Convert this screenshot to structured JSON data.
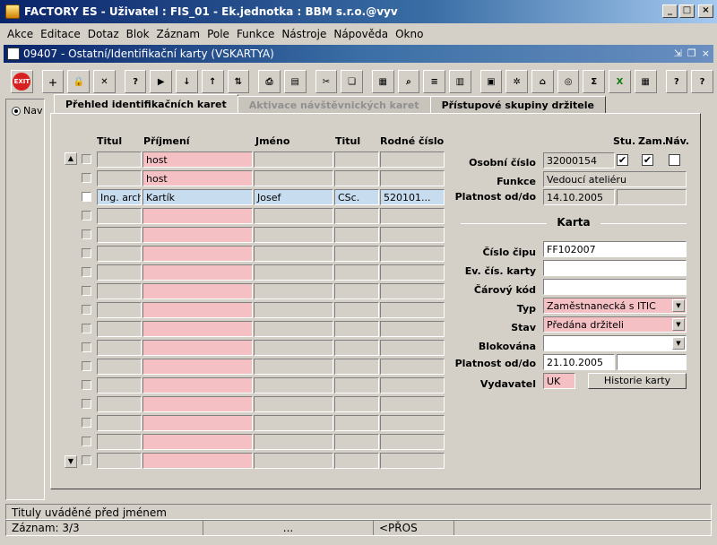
{
  "window": {
    "title": "FACTORY ES - Uživatel : FIS_01 - Ek.jednotka : BBM s.r.o.@vyv"
  },
  "menu": [
    "Akce",
    "Editace",
    "Dotaz",
    "Blok",
    "Záznam",
    "Pole",
    "Funkce",
    "Nástroje",
    "Nápověda",
    "Okno"
  ],
  "form": {
    "title": "09407 - Ostatní/Identifikační karty (VSKARTYA)"
  },
  "toolbar": {
    "exit_label": "EXIT"
  },
  "left": {
    "nav_label": "Nav"
  },
  "tabs": [
    {
      "label": "Přehled identifikačních karet"
    },
    {
      "label": "Aktivace návštěvnických karet"
    },
    {
      "label": "Přístupové skupiny držitele"
    }
  ],
  "grid": {
    "headers": {
      "titul1": "Titul",
      "prijmeni": "Příjmení",
      "jmeno": "Jméno",
      "titul2": "Titul",
      "rodne": "Rodné číslo"
    },
    "rows": [
      {
        "titul1": "",
        "prijmeni": "host",
        "jmeno": "",
        "titul2": "",
        "rodne": ""
      },
      {
        "titul1": "",
        "prijmeni": "host",
        "jmeno": "",
        "titul2": "",
        "rodne": ""
      },
      {
        "titul1": "Ing. arch.",
        "prijmeni": "Kartík",
        "jmeno": "Josef",
        "titul2": "CSc.",
        "rodne": "520101..."
      }
    ]
  },
  "detail": {
    "col_stu": "Stu.",
    "col_zam": "Zam.",
    "col_nav": "Náv.",
    "osobni_cislo_label": "Osobní číslo",
    "osobni_cislo": "32000154",
    "funkce_label": "Funkce",
    "funkce": "Vedoucí ateliéru",
    "platnost1_label": "Platnost od/do",
    "platnost1_od": "14.10.2005",
    "platnost1_do": "",
    "karta_title": "Karta",
    "cislo_cipu_label": "Číslo čipu",
    "cislo_cipu": "FF102007",
    "ev_cis_label": "Ev. čís. karty",
    "ev_cis": "",
    "carovy_label": "Čárový kód",
    "carovy": "",
    "typ_label": "Typ",
    "typ": "Zaměstnanecká s ITIC",
    "stav_label": "Stav",
    "stav": "Předána držiteli",
    "blokovana_label": "Blokována",
    "blokovana": "",
    "platnost2_label": "Platnost od/do",
    "platnost2_od": "21.10.2005",
    "platnost2_do": "",
    "vydavatel_label": "Vydavatel",
    "vydavatel": "UK",
    "historie_button": "Historie karty",
    "stu_checked": true,
    "zam_checked": true,
    "nav_checked": false
  },
  "status": {
    "message": "Tituly uváděné před jménem",
    "record": "Záznam: 3/3",
    "ellipsis": "...",
    "mode": "<PŘOS"
  }
}
